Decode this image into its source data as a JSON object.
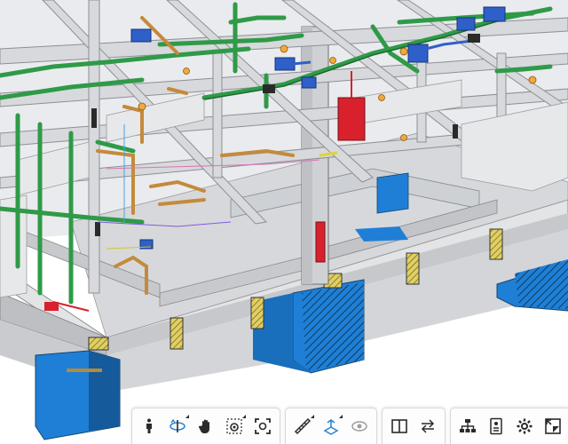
{
  "app": {
    "accent_color": "#2a85d8",
    "icon_color": "#2a2a2a",
    "model_colors": {
      "structure": "#dcdcdc",
      "pipe_green": "#2f9a48",
      "duct_blue": "#2f5fc8",
      "foundation_blue": "#1f7fd6",
      "panel_red": "#d8212d",
      "pipe_brown": "#c48a3c",
      "hatch_yellow": "#e0cf63"
    }
  },
  "toolbar": {
    "groups": [
      {
        "id": "navigation",
        "tools": [
          {
            "icon": "person-walk-icon",
            "active": false,
            "flyout": false
          },
          {
            "icon": "orbit-icon",
            "active": true,
            "flyout": true
          },
          {
            "icon": "pan-hand-icon",
            "active": false,
            "flyout": false
          },
          {
            "icon": "camera-focus-icon",
            "active": false,
            "flyout": true
          },
          {
            "icon": "fit-to-view-icon",
            "active": false,
            "flyout": false
          }
        ]
      },
      {
        "id": "measure",
        "tools": [
          {
            "icon": "measure-ruler-icon",
            "active": false,
            "flyout": true
          },
          {
            "icon": "section-box-icon",
            "active": true,
            "flyout": true
          },
          {
            "icon": "explode-view-icon",
            "active": false,
            "flyout": false,
            "disabled": true
          }
        ]
      },
      {
        "id": "compare",
        "tools": [
          {
            "icon": "split-view-icon",
            "active": false,
            "flyout": false
          },
          {
            "icon": "swap-arrows-icon",
            "active": false,
            "flyout": false
          }
        ]
      },
      {
        "id": "settings",
        "tools": [
          {
            "icon": "model-tree-icon",
            "active": false,
            "flyout": false
          },
          {
            "icon": "properties-icon",
            "active": false,
            "flyout": false
          },
          {
            "icon": "settings-gear-icon",
            "active": false,
            "flyout": false
          },
          {
            "icon": "fullscreen-icon",
            "active": false,
            "flyout": false
          }
        ]
      }
    ]
  }
}
